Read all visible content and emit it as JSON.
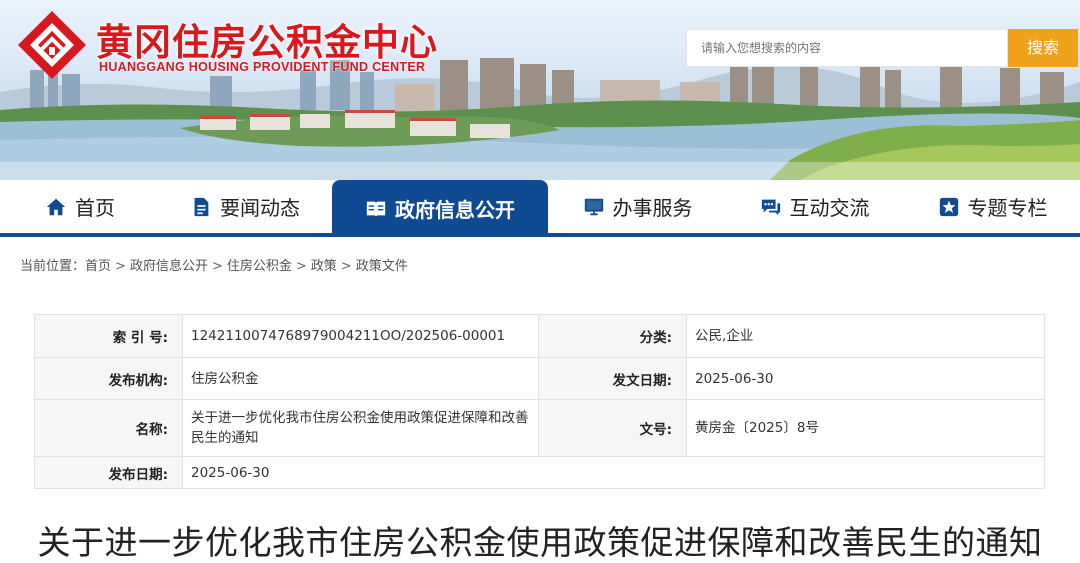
{
  "site": {
    "title": "黄冈住房公积金中心",
    "subtitle": "HUANGGANG HOUSING PROVIDENT FUND CENTER",
    "logo_icon": "diamond-logo-icon",
    "brand_color": "#d7191f"
  },
  "search": {
    "placeholder": "请输入您想搜索的内容",
    "button_label": "搜索",
    "button_color": "#f0a21c"
  },
  "nav": {
    "accent_color": "#0f4a93",
    "items": [
      {
        "label": "首页",
        "icon": "home-icon",
        "active": false
      },
      {
        "label": "要闻动态",
        "icon": "document-icon",
        "active": false
      },
      {
        "label": "政府信息公开",
        "icon": "open-book-icon",
        "active": true
      },
      {
        "label": "办事服务",
        "icon": "monitor-icon",
        "active": false
      },
      {
        "label": "互动交流",
        "icon": "chat-icon",
        "active": false
      },
      {
        "label": "专题专栏",
        "icon": "star-icon",
        "active": false
      }
    ]
  },
  "breadcrumb": {
    "prefix": "当前位置：",
    "items": [
      "首页",
      "政府信息公开",
      "住房公积金",
      "政策",
      "政策文件"
    ],
    "separator": ">"
  },
  "info": {
    "index_label": "索 引 号:",
    "index_value": "1242110074768979004211OO/202506-00001",
    "category_label": "分类:",
    "category_value": "公民,企业",
    "publisher_label": "发布机构:",
    "publisher_value": "住房公积金",
    "issue_date_label": "发文日期:",
    "issue_date_value": "2025-06-30",
    "name_label": "名称:",
    "name_value": "关于进一步优化我市住房公积金使用政策促进保障和改善民生的通知",
    "doc_no_label": "文号:",
    "doc_no_value": "黄房金〔2025〕8号",
    "publish_date_label": "发布日期:",
    "publish_date_value": "2025-06-30"
  },
  "article": {
    "title": "关于进一步优化我市住房公积金使用政策促进保障和改善民生的通知"
  }
}
